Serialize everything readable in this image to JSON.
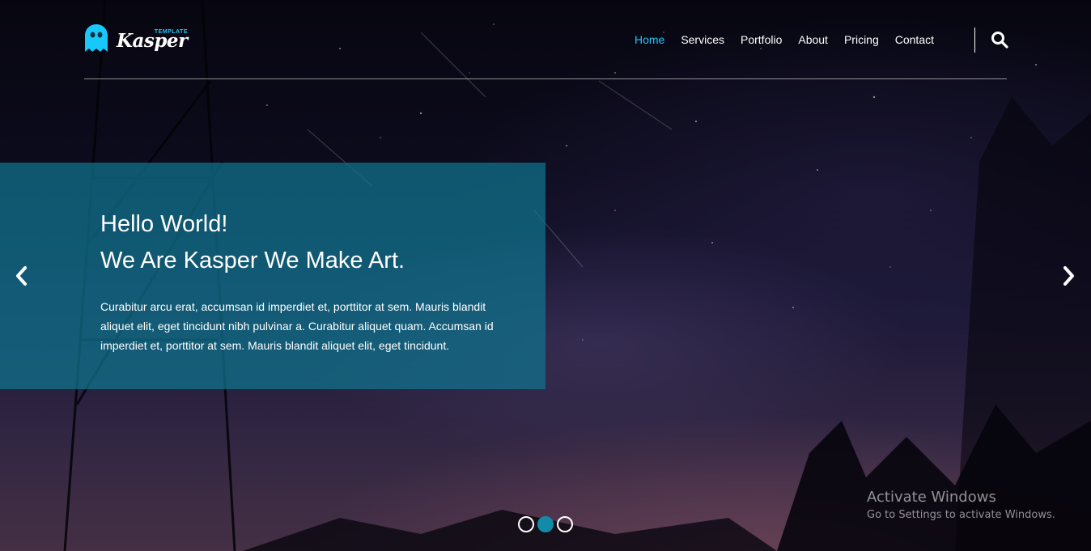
{
  "brand": {
    "name": "Kasper",
    "tagline": "TEMPLATE",
    "accent_color": "#19c8fa",
    "logo_icon": "ghost-icon"
  },
  "nav": {
    "items": [
      {
        "label": "Home",
        "active": true
      },
      {
        "label": "Services",
        "active": false
      },
      {
        "label": "Portfolio",
        "active": false
      },
      {
        "label": "About",
        "active": false
      },
      {
        "label": "Pricing",
        "active": false
      },
      {
        "label": "Contact",
        "active": false
      }
    ],
    "search_icon": "search-icon"
  },
  "hero": {
    "heading_line1": "Hello World!",
    "heading_line2": "We Are Kasper We Make Art.",
    "body": "Curabitur arcu erat, accumsan id imperdiet et, porttitor at sem. Mauris blandit aliquet elit, eget tincidunt nibh pulvinar a. Curabitur aliquet quam. Accumsan id imperdiet et, porttitor at sem. Mauris blandit aliquet elit, eget tincidunt.",
    "box_color": "#0f748f",
    "prev_icon": "chevron-left-icon",
    "next_icon": "chevron-right-icon"
  },
  "slider": {
    "count": 3,
    "active_index": 1
  },
  "watermark": {
    "title": "Activate Windows",
    "subtitle": "Go to Settings to activate Windows."
  }
}
